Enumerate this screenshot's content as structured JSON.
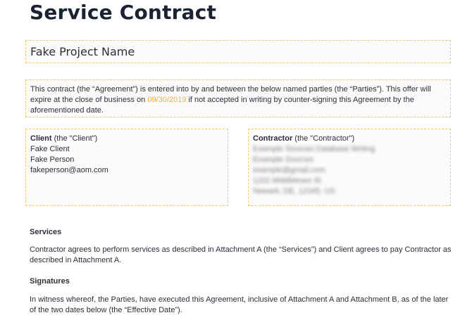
{
  "title": "Service Contract",
  "project_name": "Fake Project Name",
  "intro": {
    "part1": "This contract (the “Agreement”) is entered into by and between the below named parties (the “Parties”). This offer will expire at the close of business on ",
    "date": "09/30/2019",
    "part2": " if not accepted in writing by counter-signing this Agreement by the aforementioned date."
  },
  "client": {
    "label": "Client",
    "suffix": " (the \"Client\")",
    "lines": [
      "Fake Client",
      "Fake Person",
      "fakeperson@aom.com"
    ]
  },
  "contractor": {
    "label": "Contractor",
    "suffix": " (the \"Contractor\")",
    "lines": [
      "Example Sources Database Writing",
      "Example Sources",
      "example@gmail.com",
      "1202 Middletown St",
      "Newark, DE, 12345, US"
    ]
  },
  "services": {
    "heading": "Services",
    "text": "Contractor agrees to perform services as described in Attachment A (the “Services”) and Client agrees to pay Contractor as described in Attachment A."
  },
  "signatures": {
    "heading": "Signatures",
    "text": "In witness whereof, the Parties, have executed this Agreement, inclusive of Attachment A and Attachment B, as of the later of the two dates below (the “Effective Date”)."
  }
}
